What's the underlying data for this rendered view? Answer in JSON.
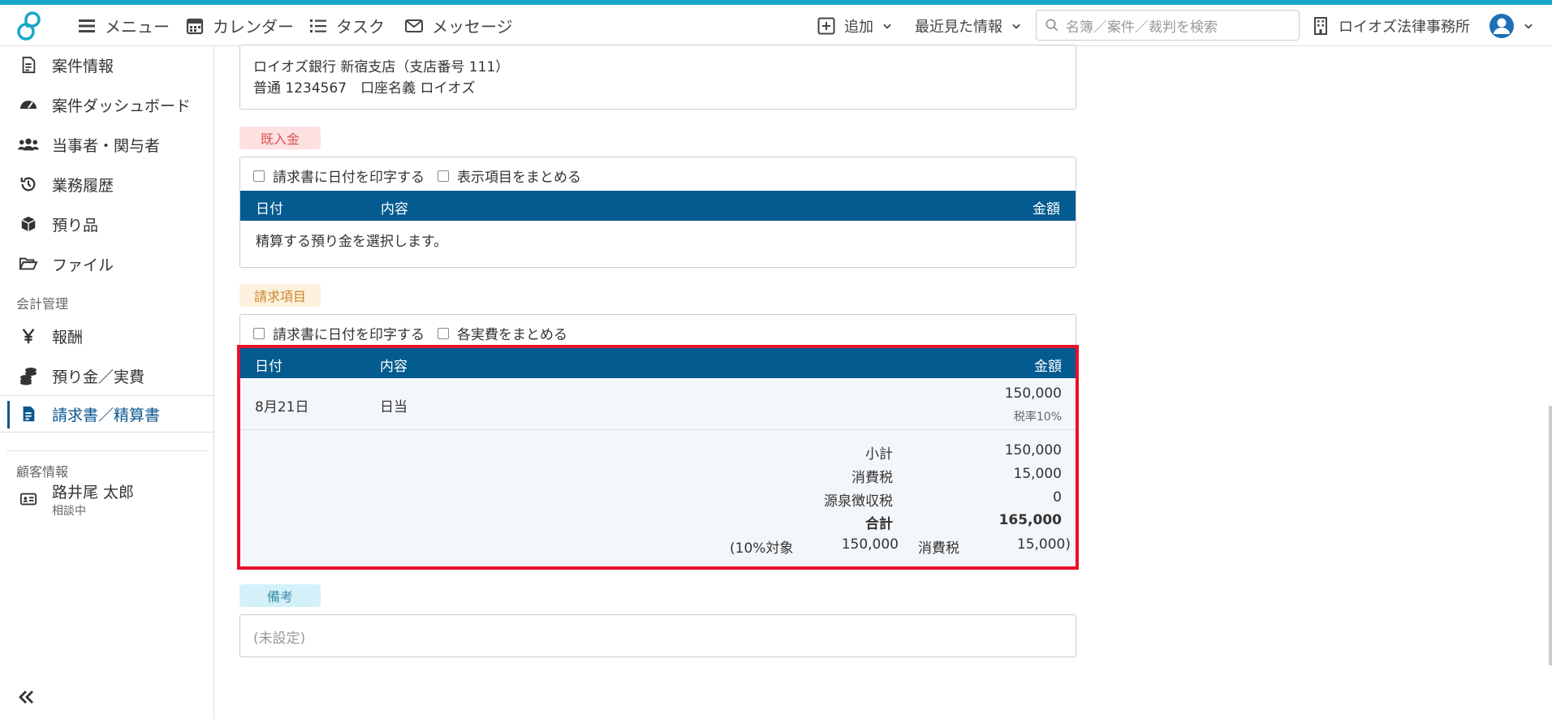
{
  "topbar": {
    "menu": "メニュー",
    "calendar": "カレンダー",
    "task": "タスク",
    "message": "メッセージ",
    "add": "追加",
    "recent": "最近見た情報",
    "search_placeholder": "名簿／案件／裁判を検索",
    "office": "ロイオズ法律事務所"
  },
  "sidebar": {
    "items": [
      {
        "label": "案件情報"
      },
      {
        "label": "案件ダッシュボード"
      },
      {
        "label": "当事者・関与者"
      },
      {
        "label": "業務履歴"
      },
      {
        "label": "預り品"
      },
      {
        "label": "ファイル"
      }
    ],
    "accounting_section": "会計管理",
    "accounting_items": [
      {
        "label": "報酬"
      },
      {
        "label": "預り金／実費"
      },
      {
        "label": "請求書／精算書"
      }
    ],
    "customer_section": "顧客情報",
    "customer_name": "路井尾 太郎",
    "customer_status": "相談中"
  },
  "bank": {
    "line1": "ロイオズ銀行 新宿支店（支店番号 111）",
    "line2": "普通 1234567　口座名義 ロイオズ"
  },
  "received": {
    "tag": "既入金",
    "chk_date": "請求書に日付を印字する",
    "chk_group": "表示項目をまとめる",
    "col_date": "日付",
    "col_content": "内容",
    "col_amount": "金額",
    "empty_text": "精算する預り金を選択します。"
  },
  "billing": {
    "tag": "請求項目",
    "chk_date": "請求書に日付を印字する",
    "chk_group": "各実費をまとめる",
    "col_date": "日付",
    "col_content": "内容",
    "col_amount": "金額",
    "rows": [
      {
        "date": "8月21日",
        "content": "日当",
        "amount": "150,000",
        "tax_rate": "税率10%"
      }
    ],
    "summary": {
      "subtotal_label": "小計",
      "subtotal": "150,000",
      "tax_label": "消費税",
      "tax": "15,000",
      "withholding_label": "源泉徴収税",
      "withholding": "0",
      "total_label": "合計",
      "total": "165,000",
      "breakdown_target_label": "(10%対象",
      "breakdown_target": "150,000",
      "breakdown_tax_label": "消費税",
      "breakdown_tax": "15,000)"
    }
  },
  "notes": {
    "tag": "備考",
    "value": "(未設定)"
  },
  "colors": {
    "accent": "#17a7c9",
    "table_header": "#035b90",
    "highlight": "#e8102a",
    "received_tag_bg": "#fde1e1",
    "received_tag_fg": "#d9534f",
    "billing_tag_bg": "#fdf0dc",
    "billing_tag_fg": "#c9882c",
    "notes_tag_bg": "#d4f1f9",
    "notes_tag_fg": "#3a8ea8"
  }
}
